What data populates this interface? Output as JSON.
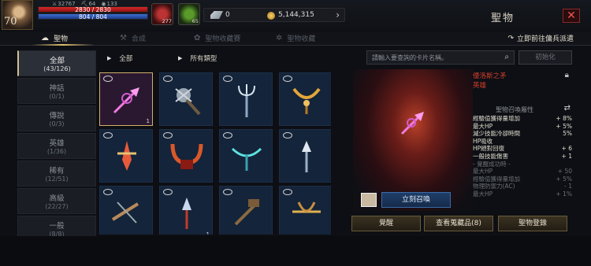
{
  "player": {
    "level": "70",
    "stat_a": "32767",
    "stat_b": "64",
    "stat_c": "133",
    "hp": "2830 / 2830",
    "mp": "804 / 804"
  },
  "consumables": {
    "potion_count": "277",
    "leaf_count": "65"
  },
  "currency": {
    "gems": "0",
    "gold": "5,144,315"
  },
  "window": {
    "title": "聖物",
    "close": "✕"
  },
  "tabs": [
    {
      "label": "聖物"
    },
    {
      "label": "合成"
    },
    {
      "label": "聖物收藏賽"
    },
    {
      "label": "聖物收藏"
    }
  ],
  "dispatch_label": "立即前往傭兵派遣",
  "nav": [
    {
      "name": "全部",
      "count": "(43/126)"
    },
    {
      "name": "神話",
      "count": "(0/1)"
    },
    {
      "name": "傳說",
      "count": "(0/3)"
    },
    {
      "name": "英雄",
      "count": "(1/36)"
    },
    {
      "name": "稀有",
      "count": "(12/51)"
    },
    {
      "name": "高級",
      "count": "(22/27)"
    },
    {
      "name": "一般",
      "count": "(8/8)"
    }
  ],
  "filters": {
    "grade": "全部",
    "type": "所有類型"
  },
  "grid": {
    "first_count": "1",
    "count_row3": "1"
  },
  "search": {
    "placeholder": "請輸入要查詢的卡片名稱。"
  },
  "reset_label": "初始化",
  "detail": {
    "name": "優洛斯之矛",
    "rarity": "英雄",
    "effects_header": "聖物召喚屬性",
    "effects": [
      {
        "k": "經驗值獲得量增加",
        "v": "+ 8%"
      },
      {
        "k": "最大HP",
        "v": "+ 5%"
      },
      {
        "k": "減少技能冷卻時間",
        "v": "5%"
      },
      {
        "k": "HP吸收",
        "v": ""
      },
      {
        "k": "HP絕對回復",
        "v": "+ 6"
      },
      {
        "k": "一般技能傷害",
        "v": "+ 1"
      }
    ],
    "collection_header": "- 覺醒成功時 -",
    "collection": [
      {
        "k": "最大HP",
        "v": "+ 50"
      },
      {
        "k": "經驗值獲得量增加",
        "v": "+ 5%"
      },
      {
        "k": "物理防禦力(AC)",
        "v": "- 1"
      },
      {
        "k": "最大HP",
        "v": "+ 1%"
      }
    ],
    "summon_label": "立刻召喚",
    "portrait_count": "1"
  },
  "buttons": {
    "awaken": "覺醒",
    "view_collection": "查看蒐藏品(8)",
    "register": "聖物登錄"
  }
}
